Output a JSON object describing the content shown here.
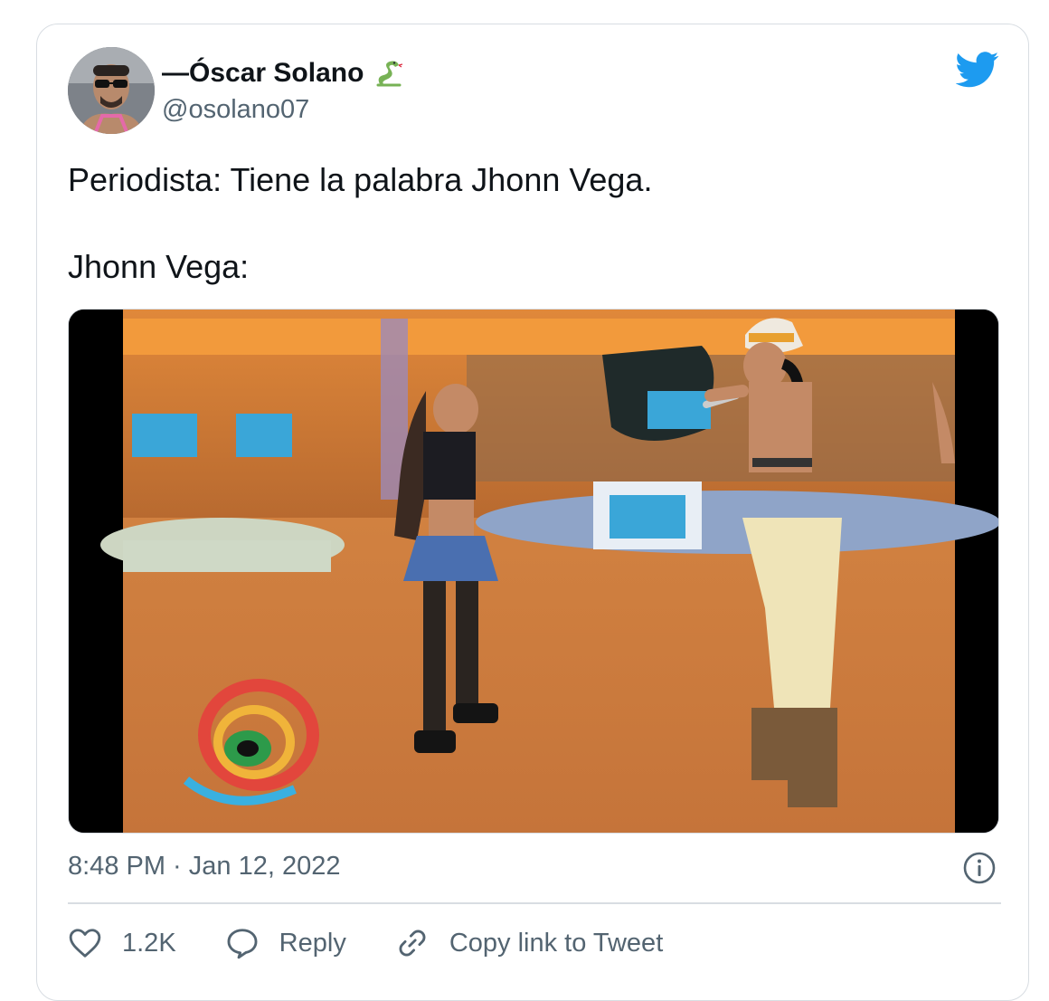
{
  "author": {
    "name_prefix": "—",
    "name": "Óscar Solano",
    "handle": "@osolano07",
    "name_emoji": "snake-emoji-icon"
  },
  "brand": {
    "icon": "twitter-bird-icon",
    "color": "#1d9bf0"
  },
  "tweet": {
    "line1": "Periodista: Tiene la palabra Jhonn Vega.",
    "line2": "Jhonn Vega:"
  },
  "media": {
    "type": "video-still"
  },
  "meta": {
    "timestamp": "8:48 PM · Jan 12, 2022"
  },
  "actions": {
    "likes": "1.2K",
    "reply_label": "Reply",
    "copy_label": "Copy link to Tweet"
  },
  "colors": {
    "text": "#0f1419",
    "secondary": "#536471",
    "border": "#d8dde2"
  }
}
